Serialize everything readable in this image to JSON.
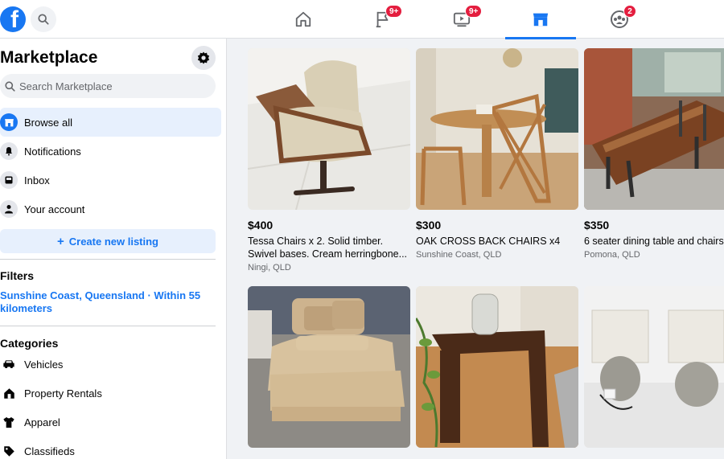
{
  "topbar": {
    "logo": "facebook-logo",
    "search_icon": "search-icon",
    "tabs": [
      {
        "name": "home",
        "icon": "home-icon",
        "badge": ""
      },
      {
        "name": "pages",
        "icon": "flag-icon",
        "badge": "9+"
      },
      {
        "name": "watch",
        "icon": "video-icon",
        "badge": "9+"
      },
      {
        "name": "marketplace",
        "icon": "store-icon",
        "badge": "",
        "active": true
      },
      {
        "name": "groups",
        "icon": "groups-icon",
        "badge": "2"
      }
    ]
  },
  "sidebar": {
    "title": "Marketplace",
    "search_placeholder": "Search Marketplace",
    "nav": [
      {
        "label": "Browse all",
        "icon": "store-icon",
        "active": true
      },
      {
        "label": "Notifications",
        "icon": "bell-icon"
      },
      {
        "label": "Inbox",
        "icon": "inbox-icon"
      },
      {
        "label": "Your account",
        "icon": "person-icon"
      }
    ],
    "create_label": "Create new listing",
    "filters_heading": "Filters",
    "location": "Sunshine Coast, Queensland · Within 55 kilometers",
    "categories_heading": "Categories",
    "categories": [
      {
        "label": "Vehicles",
        "icon": "car-icon"
      },
      {
        "label": "Property Rentals",
        "icon": "house-icon"
      },
      {
        "label": "Apparel",
        "icon": "shirt-icon"
      },
      {
        "label": "Classifieds",
        "icon": "tag-icon"
      }
    ]
  },
  "listings": [
    {
      "price": "$400",
      "title_line1": "Tessa Chairs x 2. Solid timber.",
      "title_line2": "Swivel bases. Cream herringbone...",
      "location": "Ningi, QLD"
    },
    {
      "price": "$300",
      "title_line1": "OAK CROSS BACK CHAIRS x4",
      "title_line2": "",
      "location": "Sunshine Coast, QLD"
    },
    {
      "price": "$350",
      "title_line1": "6 seater dining table and chairs",
      "title_line2": "",
      "location": "Pomona, QLD"
    }
  ],
  "colors": {
    "brand": "#1877f2",
    "badge": "#e41e3f"
  }
}
